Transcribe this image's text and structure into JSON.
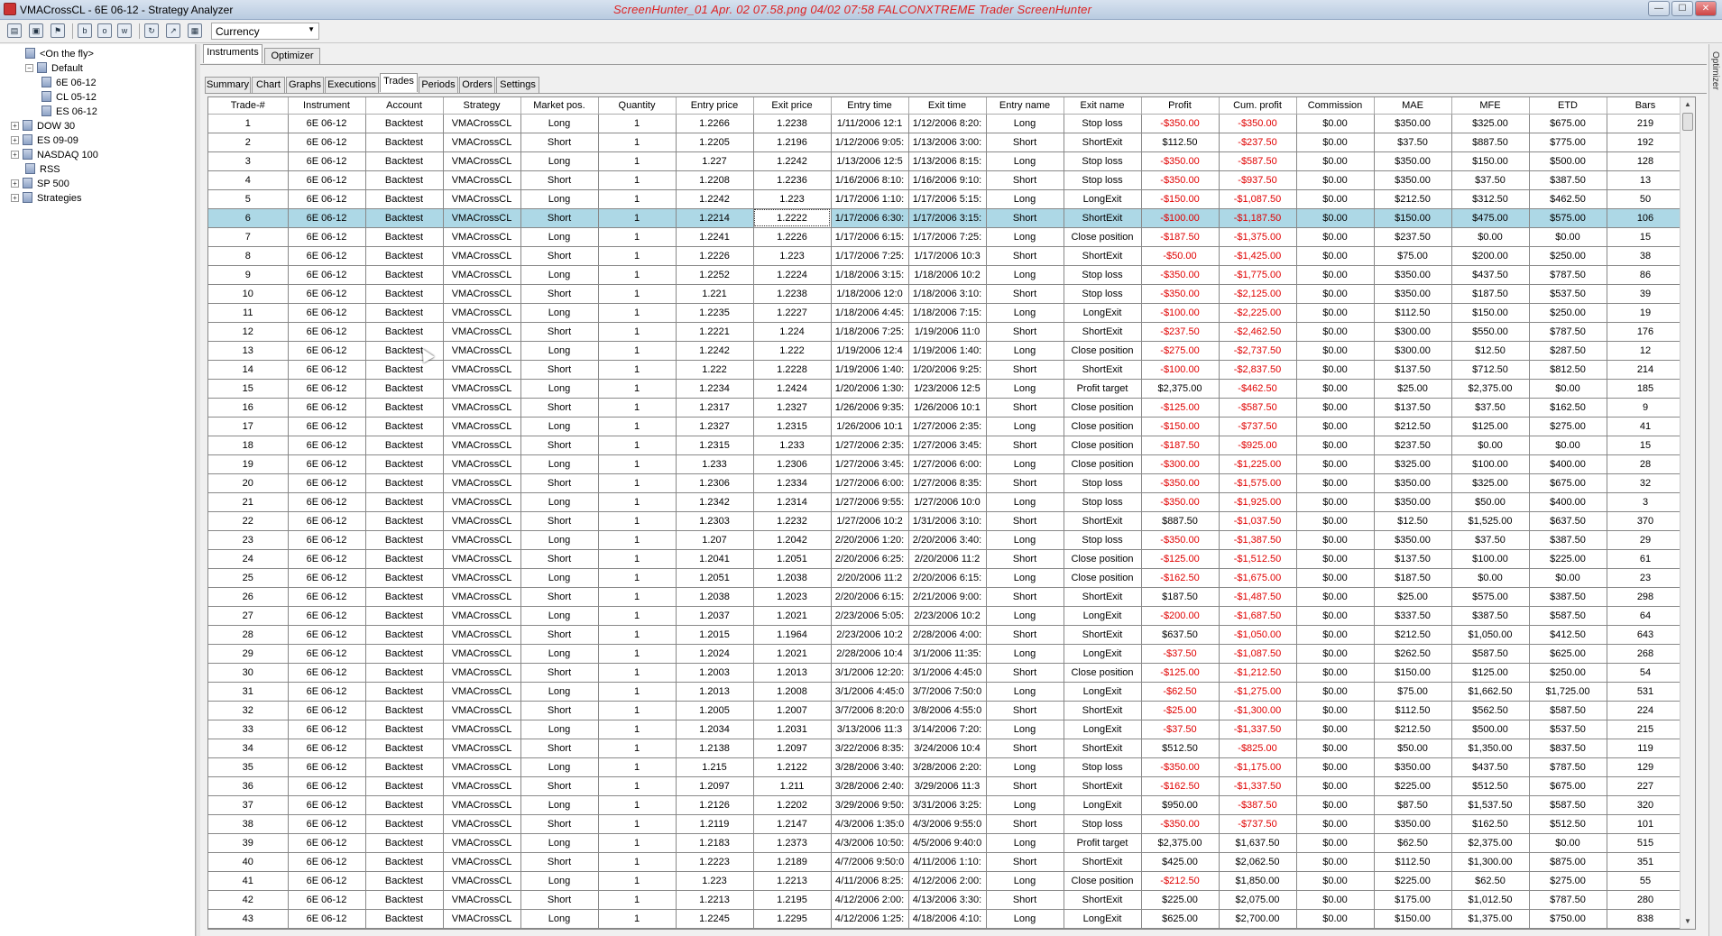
{
  "window": {
    "title": "VMACrossCL - 6E 06-12 - Strategy Analyzer",
    "watermark": "ScreenHunter_01 Apr. 02 07.58.png  04/02  07:58  FALCONXTREME  Trader  ScreenHunter",
    "minimize": "—",
    "maximize": "☐",
    "close": "✕"
  },
  "toolbar": {
    "currency_value": "Currency",
    "dropdown_arrow": "▼",
    "icons": [
      "open-folder-icon",
      "save-icon",
      "flag-icon",
      "b-icon",
      "o-icon",
      "w-icon",
      "refresh-icon",
      "link-icon",
      "grid-icon"
    ],
    "letters": {
      "b": "b",
      "o": "o",
      "w": "w"
    }
  },
  "tree": {
    "items": [
      {
        "label": "<On the fly>",
        "expander": ""
      },
      {
        "label": "Default",
        "expander": "−"
      },
      {
        "label": "6E 06-12",
        "expander": ""
      },
      {
        "label": "CL 05-12",
        "expander": ""
      },
      {
        "label": "ES 06-12",
        "expander": ""
      },
      {
        "label": "DOW 30",
        "expander": "+"
      },
      {
        "label": "ES 09-09",
        "expander": "+"
      },
      {
        "label": "NASDAQ 100",
        "expander": "+"
      },
      {
        "label": "RSS",
        "expander": ""
      },
      {
        "label": "SP 500",
        "expander": "+"
      },
      {
        "label": "Strategies",
        "expander": "+"
      }
    ]
  },
  "tabs_top": [
    {
      "label": "Instruments",
      "active": true
    },
    {
      "label": "Optimizer",
      "active": false
    }
  ],
  "tabs_second": [
    {
      "label": "Summary"
    },
    {
      "label": "Chart"
    },
    {
      "label": "Graphs"
    },
    {
      "label": "Executions"
    },
    {
      "label": "Trades"
    },
    {
      "label": "Periods"
    },
    {
      "label": "Orders"
    },
    {
      "label": "Settings"
    }
  ],
  "active_tab": "Trades",
  "side_label": "Optimizer",
  "columns": [
    "Trade-#",
    "Instrument",
    "Account",
    "Strategy",
    "Market pos.",
    "Quantity",
    "Entry price",
    "Exit price",
    "Entry time",
    "Exit time",
    "Entry name",
    "Exit name",
    "Profit",
    "Cum. profit",
    "Commission",
    "MAE",
    "MFE",
    "ETD",
    "Bars"
  ],
  "selected_trade": "6",
  "scroll": {
    "up": "▲",
    "down": "▼"
  },
  "rows": [
    [
      "1",
      "6E 06-12",
      "Backtest",
      "VMACrossCL",
      "Long",
      "1",
      "1.2266",
      "1.2238",
      "1/11/2006 12:1",
      "1/12/2006 8:20:",
      "Long",
      "Stop loss",
      "-$350.00",
      "-$350.00",
      "$0.00",
      "$350.00",
      "$325.00",
      "$675.00",
      "219"
    ],
    [
      "2",
      "6E 06-12",
      "Backtest",
      "VMACrossCL",
      "Short",
      "1",
      "1.2205",
      "1.2196",
      "1/12/2006 9:05:",
      "1/13/2006 3:00:",
      "Short",
      "ShortExit",
      "$112.50",
      "-$237.50",
      "$0.00",
      "$37.50",
      "$887.50",
      "$775.00",
      "192"
    ],
    [
      "3",
      "6E 06-12",
      "Backtest",
      "VMACrossCL",
      "Long",
      "1",
      "1.227",
      "1.2242",
      "1/13/2006 12:5",
      "1/13/2006 8:15:",
      "Long",
      "Stop loss",
      "-$350.00",
      "-$587.50",
      "$0.00",
      "$350.00",
      "$150.00",
      "$500.00",
      "128"
    ],
    [
      "4",
      "6E 06-12",
      "Backtest",
      "VMACrossCL",
      "Short",
      "1",
      "1.2208",
      "1.2236",
      "1/16/2006 8:10:",
      "1/16/2006 9:10:",
      "Short",
      "Stop loss",
      "-$350.00",
      "-$937.50",
      "$0.00",
      "$350.00",
      "$37.50",
      "$387.50",
      "13"
    ],
    [
      "5",
      "6E 06-12",
      "Backtest",
      "VMACrossCL",
      "Long",
      "1",
      "1.2242",
      "1.223",
      "1/17/2006 1:10:",
      "1/17/2006 5:15:",
      "Long",
      "LongExit",
      "-$150.00",
      "-$1,087.50",
      "$0.00",
      "$212.50",
      "$312.50",
      "$462.50",
      "50"
    ],
    [
      "6",
      "6E 06-12",
      "Backtest",
      "VMACrossCL",
      "Short",
      "1",
      "1.2214",
      "1.2222",
      "1/17/2006 6:30:",
      "1/17/2006 3:15:",
      "Short",
      "ShortExit",
      "-$100.00",
      "-$1,187.50",
      "$0.00",
      "$150.00",
      "$475.00",
      "$575.00",
      "106"
    ],
    [
      "7",
      "6E 06-12",
      "Backtest",
      "VMACrossCL",
      "Long",
      "1",
      "1.2241",
      "1.2226",
      "1/17/2006 6:15:",
      "1/17/2006 7:25:",
      "Long",
      "Close position",
      "-$187.50",
      "-$1,375.00",
      "$0.00",
      "$237.50",
      "$0.00",
      "$0.00",
      "15"
    ],
    [
      "8",
      "6E 06-12",
      "Backtest",
      "VMACrossCL",
      "Short",
      "1",
      "1.2226",
      "1.223",
      "1/17/2006 7:25:",
      "1/17/2006 10:3",
      "Short",
      "ShortExit",
      "-$50.00",
      "-$1,425.00",
      "$0.00",
      "$75.00",
      "$200.00",
      "$250.00",
      "38"
    ],
    [
      "9",
      "6E 06-12",
      "Backtest",
      "VMACrossCL",
      "Long",
      "1",
      "1.2252",
      "1.2224",
      "1/18/2006 3:15:",
      "1/18/2006 10:2",
      "Long",
      "Stop loss",
      "-$350.00",
      "-$1,775.00",
      "$0.00",
      "$350.00",
      "$437.50",
      "$787.50",
      "86"
    ],
    [
      "10",
      "6E 06-12",
      "Backtest",
      "VMACrossCL",
      "Short",
      "1",
      "1.221",
      "1.2238",
      "1/18/2006 12:0",
      "1/18/2006 3:10:",
      "Short",
      "Stop loss",
      "-$350.00",
      "-$2,125.00",
      "$0.00",
      "$350.00",
      "$187.50",
      "$537.50",
      "39"
    ],
    [
      "11",
      "6E 06-12",
      "Backtest",
      "VMACrossCL",
      "Long",
      "1",
      "1.2235",
      "1.2227",
      "1/18/2006 4:45:",
      "1/18/2006 7:15:",
      "Long",
      "LongExit",
      "-$100.00",
      "-$2,225.00",
      "$0.00",
      "$112.50",
      "$150.00",
      "$250.00",
      "19"
    ],
    [
      "12",
      "6E 06-12",
      "Backtest",
      "VMACrossCL",
      "Short",
      "1",
      "1.2221",
      "1.224",
      "1/18/2006 7:25:",
      "1/19/2006 11:0",
      "Short",
      "ShortExit",
      "-$237.50",
      "-$2,462.50",
      "$0.00",
      "$300.00",
      "$550.00",
      "$787.50",
      "176"
    ],
    [
      "13",
      "6E 06-12",
      "Backtest",
      "VMACrossCL",
      "Long",
      "1",
      "1.2242",
      "1.222",
      "1/19/2006 12:4",
      "1/19/2006 1:40:",
      "Long",
      "Close position",
      "-$275.00",
      "-$2,737.50",
      "$0.00",
      "$300.00",
      "$12.50",
      "$287.50",
      "12"
    ],
    [
      "14",
      "6E 06-12",
      "Backtest",
      "VMACrossCL",
      "Short",
      "1",
      "1.222",
      "1.2228",
      "1/19/2006 1:40:",
      "1/20/2006 9:25:",
      "Short",
      "ShortExit",
      "-$100.00",
      "-$2,837.50",
      "$0.00",
      "$137.50",
      "$712.50",
      "$812.50",
      "214"
    ],
    [
      "15",
      "6E 06-12",
      "Backtest",
      "VMACrossCL",
      "Long",
      "1",
      "1.2234",
      "1.2424",
      "1/20/2006 1:30:",
      "1/23/2006 12:5",
      "Long",
      "Profit target",
      "$2,375.00",
      "-$462.50",
      "$0.00",
      "$25.00",
      "$2,375.00",
      "$0.00",
      "185"
    ],
    [
      "16",
      "6E 06-12",
      "Backtest",
      "VMACrossCL",
      "Short",
      "1",
      "1.2317",
      "1.2327",
      "1/26/2006 9:35:",
      "1/26/2006 10:1",
      "Short",
      "Close position",
      "-$125.00",
      "-$587.50",
      "$0.00",
      "$137.50",
      "$37.50",
      "$162.50",
      "9"
    ],
    [
      "17",
      "6E 06-12",
      "Backtest",
      "VMACrossCL",
      "Long",
      "1",
      "1.2327",
      "1.2315",
      "1/26/2006 10:1",
      "1/27/2006 2:35:",
      "Long",
      "Close position",
      "-$150.00",
      "-$737.50",
      "$0.00",
      "$212.50",
      "$125.00",
      "$275.00",
      "41"
    ],
    [
      "18",
      "6E 06-12",
      "Backtest",
      "VMACrossCL",
      "Short",
      "1",
      "1.2315",
      "1.233",
      "1/27/2006 2:35:",
      "1/27/2006 3:45:",
      "Short",
      "Close position",
      "-$187.50",
      "-$925.00",
      "$0.00",
      "$237.50",
      "$0.00",
      "$0.00",
      "15"
    ],
    [
      "19",
      "6E 06-12",
      "Backtest",
      "VMACrossCL",
      "Long",
      "1",
      "1.233",
      "1.2306",
      "1/27/2006 3:45:",
      "1/27/2006 6:00:",
      "Long",
      "Close position",
      "-$300.00",
      "-$1,225.00",
      "$0.00",
      "$325.00",
      "$100.00",
      "$400.00",
      "28"
    ],
    [
      "20",
      "6E 06-12",
      "Backtest",
      "VMACrossCL",
      "Short",
      "1",
      "1.2306",
      "1.2334",
      "1/27/2006 6:00:",
      "1/27/2006 8:35:",
      "Short",
      "Stop loss",
      "-$350.00",
      "-$1,575.00",
      "$0.00",
      "$350.00",
      "$325.00",
      "$675.00",
      "32"
    ],
    [
      "21",
      "6E 06-12",
      "Backtest",
      "VMACrossCL",
      "Long",
      "1",
      "1.2342",
      "1.2314",
      "1/27/2006 9:55:",
      "1/27/2006 10:0",
      "Long",
      "Stop loss",
      "-$350.00",
      "-$1,925.00",
      "$0.00",
      "$350.00",
      "$50.00",
      "$400.00",
      "3"
    ],
    [
      "22",
      "6E 06-12",
      "Backtest",
      "VMACrossCL",
      "Short",
      "1",
      "1.2303",
      "1.2232",
      "1/27/2006 10:2",
      "1/31/2006 3:10:",
      "Short",
      "ShortExit",
      "$887.50",
      "-$1,037.50",
      "$0.00",
      "$12.50",
      "$1,525.00",
      "$637.50",
      "370"
    ],
    [
      "23",
      "6E 06-12",
      "Backtest",
      "VMACrossCL",
      "Long",
      "1",
      "1.207",
      "1.2042",
      "2/20/2006 1:20:",
      "2/20/2006 3:40:",
      "Long",
      "Stop loss",
      "-$350.00",
      "-$1,387.50",
      "$0.00",
      "$350.00",
      "$37.50",
      "$387.50",
      "29"
    ],
    [
      "24",
      "6E 06-12",
      "Backtest",
      "VMACrossCL",
      "Short",
      "1",
      "1.2041",
      "1.2051",
      "2/20/2006 6:25:",
      "2/20/2006 11:2",
      "Short",
      "Close position",
      "-$125.00",
      "-$1,512.50",
      "$0.00",
      "$137.50",
      "$100.00",
      "$225.00",
      "61"
    ],
    [
      "25",
      "6E 06-12",
      "Backtest",
      "VMACrossCL",
      "Long",
      "1",
      "1.2051",
      "1.2038",
      "2/20/2006 11:2",
      "2/20/2006 6:15:",
      "Long",
      "Close position",
      "-$162.50",
      "-$1,675.00",
      "$0.00",
      "$187.50",
      "$0.00",
      "$0.00",
      "23"
    ],
    [
      "26",
      "6E 06-12",
      "Backtest",
      "VMACrossCL",
      "Short",
      "1",
      "1.2038",
      "1.2023",
      "2/20/2006 6:15:",
      "2/21/2006 9:00:",
      "Short",
      "ShortExit",
      "$187.50",
      "-$1,487.50",
      "$0.00",
      "$25.00",
      "$575.00",
      "$387.50",
      "298"
    ],
    [
      "27",
      "6E 06-12",
      "Backtest",
      "VMACrossCL",
      "Long",
      "1",
      "1.2037",
      "1.2021",
      "2/23/2006 5:05:",
      "2/23/2006 10:2",
      "Long",
      "LongExit",
      "-$200.00",
      "-$1,687.50",
      "$0.00",
      "$337.50",
      "$387.50",
      "$587.50",
      "64"
    ],
    [
      "28",
      "6E 06-12",
      "Backtest",
      "VMACrossCL",
      "Short",
      "1",
      "1.2015",
      "1.1964",
      "2/23/2006 10:2",
      "2/28/2006 4:00:",
      "Short",
      "ShortExit",
      "$637.50",
      "-$1,050.00",
      "$0.00",
      "$212.50",
      "$1,050.00",
      "$412.50",
      "643"
    ],
    [
      "29",
      "6E 06-12",
      "Backtest",
      "VMACrossCL",
      "Long",
      "1",
      "1.2024",
      "1.2021",
      "2/28/2006 10:4",
      "3/1/2006 11:35:",
      "Long",
      "LongExit",
      "-$37.50",
      "-$1,087.50",
      "$0.00",
      "$262.50",
      "$587.50",
      "$625.00",
      "268"
    ],
    [
      "30",
      "6E 06-12",
      "Backtest",
      "VMACrossCL",
      "Short",
      "1",
      "1.2003",
      "1.2013",
      "3/1/2006 12:20:",
      "3/1/2006 4:45:0",
      "Short",
      "Close position",
      "-$125.00",
      "-$1,212.50",
      "$0.00",
      "$150.00",
      "$125.00",
      "$250.00",
      "54"
    ],
    [
      "31",
      "6E 06-12",
      "Backtest",
      "VMACrossCL",
      "Long",
      "1",
      "1.2013",
      "1.2008",
      "3/1/2006 4:45:0",
      "3/7/2006 7:50:0",
      "Long",
      "LongExit",
      "-$62.50",
      "-$1,275.00",
      "$0.00",
      "$75.00",
      "$1,662.50",
      "$1,725.00",
      "531"
    ],
    [
      "32",
      "6E 06-12",
      "Backtest",
      "VMACrossCL",
      "Short",
      "1",
      "1.2005",
      "1.2007",
      "3/7/2006 8:20:0",
      "3/8/2006 4:55:0",
      "Short",
      "ShortExit",
      "-$25.00",
      "-$1,300.00",
      "$0.00",
      "$112.50",
      "$562.50",
      "$587.50",
      "224"
    ],
    [
      "33",
      "6E 06-12",
      "Backtest",
      "VMACrossCL",
      "Long",
      "1",
      "1.2034",
      "1.2031",
      "3/13/2006 11:3",
      "3/14/2006 7:20:",
      "Long",
      "LongExit",
      "-$37.50",
      "-$1,337.50",
      "$0.00",
      "$212.50",
      "$500.00",
      "$537.50",
      "215"
    ],
    [
      "34",
      "6E 06-12",
      "Backtest",
      "VMACrossCL",
      "Short",
      "1",
      "1.2138",
      "1.2097",
      "3/22/2006 8:35:",
      "3/24/2006 10:4",
      "Short",
      "ShortExit",
      "$512.50",
      "-$825.00",
      "$0.00",
      "$50.00",
      "$1,350.00",
      "$837.50",
      "119"
    ],
    [
      "35",
      "6E 06-12",
      "Backtest",
      "VMACrossCL",
      "Long",
      "1",
      "1.215",
      "1.2122",
      "3/28/2006 3:40:",
      "3/28/2006 2:20:",
      "Long",
      "Stop loss",
      "-$350.00",
      "-$1,175.00",
      "$0.00",
      "$350.00",
      "$437.50",
      "$787.50",
      "129"
    ],
    [
      "36",
      "6E 06-12",
      "Backtest",
      "VMACrossCL",
      "Short",
      "1",
      "1.2097",
      "1.211",
      "3/28/2006 2:40:",
      "3/29/2006 11:3",
      "Short",
      "ShortExit",
      "-$162.50",
      "-$1,337.50",
      "$0.00",
      "$225.00",
      "$512.50",
      "$675.00",
      "227"
    ],
    [
      "37",
      "6E 06-12",
      "Backtest",
      "VMACrossCL",
      "Long",
      "1",
      "1.2126",
      "1.2202",
      "3/29/2006 9:50:",
      "3/31/2006 3:25:",
      "Long",
      "LongExit",
      "$950.00",
      "-$387.50",
      "$0.00",
      "$87.50",
      "$1,537.50",
      "$587.50",
      "320"
    ],
    [
      "38",
      "6E 06-12",
      "Backtest",
      "VMACrossCL",
      "Short",
      "1",
      "1.2119",
      "1.2147",
      "4/3/2006 1:35:0",
      "4/3/2006 9:55:0",
      "Short",
      "Stop loss",
      "-$350.00",
      "-$737.50",
      "$0.00",
      "$350.00",
      "$162.50",
      "$512.50",
      "101"
    ],
    [
      "39",
      "6E 06-12",
      "Backtest",
      "VMACrossCL",
      "Long",
      "1",
      "1.2183",
      "1.2373",
      "4/3/2006 10:50:",
      "4/5/2006 9:40:0",
      "Long",
      "Profit target",
      "$2,375.00",
      "$1,637.50",
      "$0.00",
      "$62.50",
      "$2,375.00",
      "$0.00",
      "515"
    ],
    [
      "40",
      "6E 06-12",
      "Backtest",
      "VMACrossCL",
      "Short",
      "1",
      "1.2223",
      "1.2189",
      "4/7/2006 9:50:0",
      "4/11/2006 1:10:",
      "Short",
      "ShortExit",
      "$425.00",
      "$2,062.50",
      "$0.00",
      "$112.50",
      "$1,300.00",
      "$875.00",
      "351"
    ],
    [
      "41",
      "6E 06-12",
      "Backtest",
      "VMACrossCL",
      "Long",
      "1",
      "1.223",
      "1.2213",
      "4/11/2006 8:25:",
      "4/12/2006 2:00:",
      "Long",
      "Close position",
      "-$212.50",
      "$1,850.00",
      "$0.00",
      "$225.00",
      "$62.50",
      "$275.00",
      "55"
    ],
    [
      "42",
      "6E 06-12",
      "Backtest",
      "VMACrossCL",
      "Short",
      "1",
      "1.2213",
      "1.2195",
      "4/12/2006 2:00:",
      "4/13/2006 3:30:",
      "Short",
      "ShortExit",
      "$225.00",
      "$2,075.00",
      "$0.00",
      "$175.00",
      "$1,012.50",
      "$787.50",
      "280"
    ],
    [
      "43",
      "6E 06-12",
      "Backtest",
      "VMACrossCL",
      "Long",
      "1",
      "1.2245",
      "1.2295",
      "4/12/2006 1:25:",
      "4/18/2006 4:10:",
      "Long",
      "LongExit",
      "$625.00",
      "$2,700.00",
      "$0.00",
      "$150.00",
      "$1,375.00",
      "$750.00",
      "838"
    ]
  ]
}
